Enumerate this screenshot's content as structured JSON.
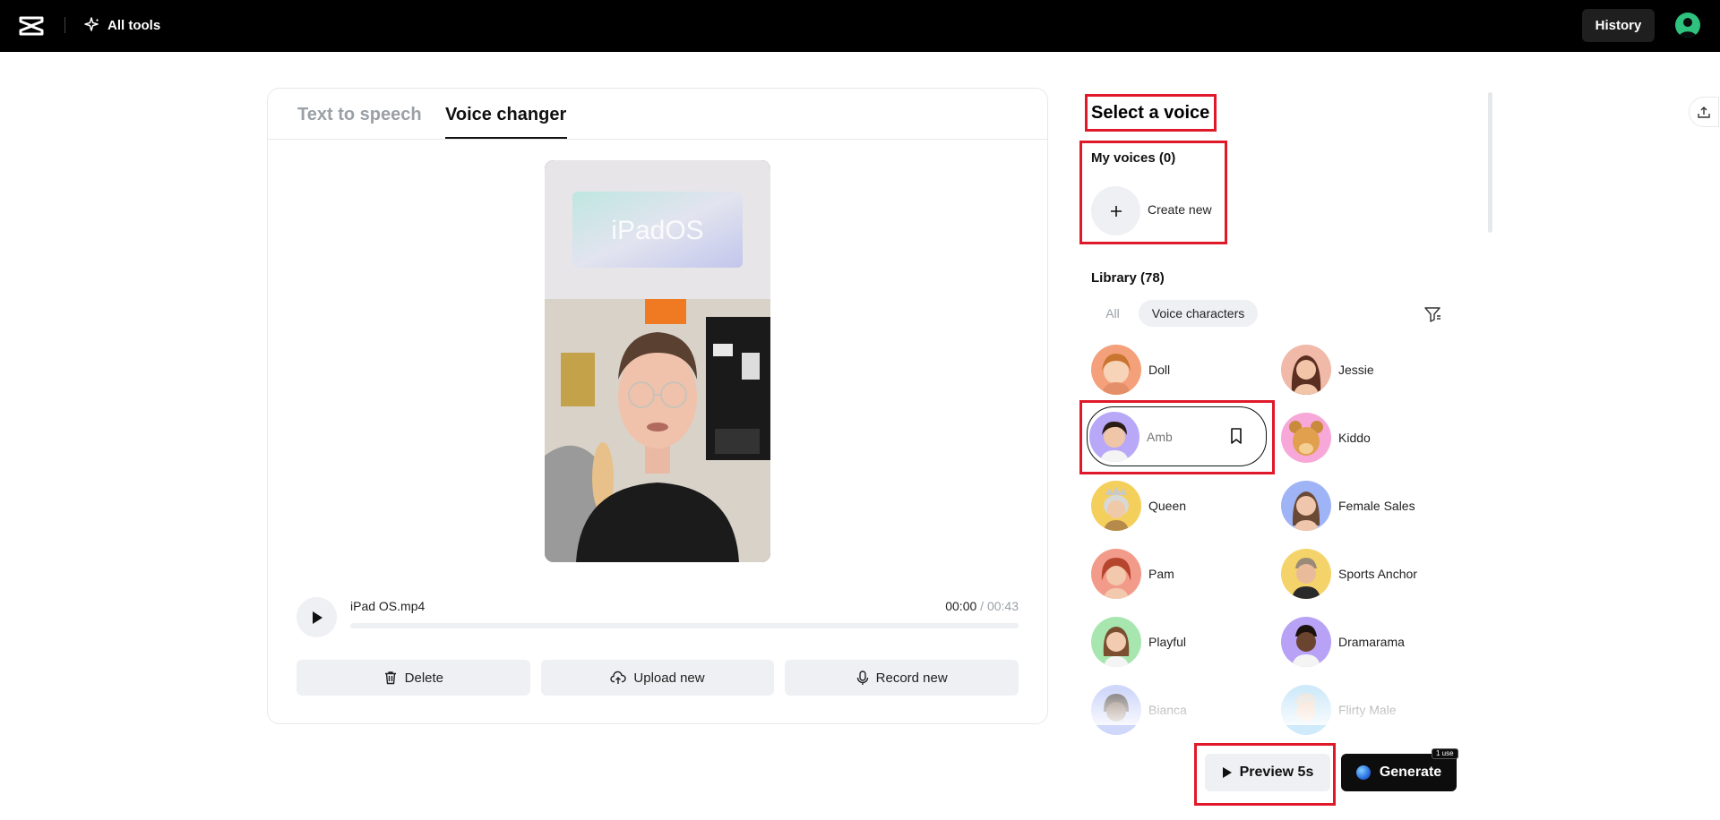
{
  "topbar": {
    "all_tools_label": "All tools",
    "history_label": "History"
  },
  "tabs": [
    {
      "label": "Text to speech",
      "active": false
    },
    {
      "label": "Voice changer",
      "active": true
    }
  ],
  "video": {
    "overlay_text": "iPadOS"
  },
  "player": {
    "filename": "iPad OS.mp4",
    "current_time": "00:00",
    "duration": "/ 00:43"
  },
  "actions": {
    "delete_label": "Delete",
    "upload_label": "Upload new",
    "record_label": "Record new"
  },
  "voices_panel": {
    "title": "Select a voice",
    "my_voices_label": "My voices (0)",
    "create_new_label": "Create new",
    "library_label": "Library (78)",
    "chips": {
      "all": "All",
      "voice_characters": "Voice characters"
    },
    "voices": [
      {
        "name": "Doll",
        "color": "#f4a07a"
      },
      {
        "name": "Jessie",
        "color": "#f0b9a8"
      },
      {
        "name": "Amb",
        "color": "#b9a8f7"
      },
      {
        "name": "Kiddo",
        "color": "#f7a8d8"
      },
      {
        "name": "Queen",
        "color": "#f5cf5b"
      },
      {
        "name": "Female Sales",
        "color": "#9fb3f7"
      },
      {
        "name": "Pam",
        "color": "#f29b8a"
      },
      {
        "name": "Sports Anchor",
        "color": "#f5d36b"
      },
      {
        "name": "Playful",
        "color": "#a8e6b0"
      },
      {
        "name": "Dramarama",
        "color": "#b8a2f5"
      },
      {
        "name": "Bianca",
        "color": "#a9b8f7"
      },
      {
        "name": "Flirty Male",
        "color": "#a9d9f7"
      }
    ]
  },
  "bottom": {
    "preview_label": "Preview 5s",
    "generate_label": "Generate",
    "badge": "1 use"
  }
}
